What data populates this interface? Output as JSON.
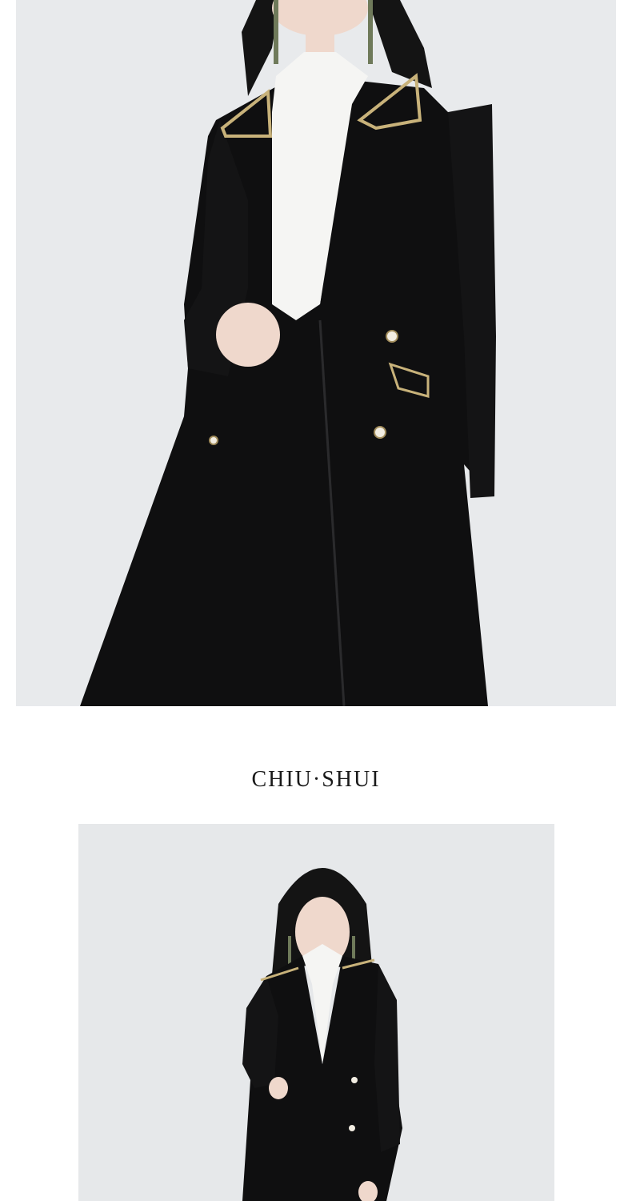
{
  "brand": {
    "name": "CHIU·SHUI"
  },
  "images": [
    {
      "name": "model-closeup",
      "subject": "woman-in-black-coat-closeup"
    },
    {
      "name": "model-full",
      "subject": "woman-in-black-coat-full"
    }
  ],
  "colors": {
    "background": "#ffffff",
    "photo_bg": "#e6e8ea",
    "coat": "#0f0f10",
    "blouse": "#f4f4f2",
    "trim": "#c8b27a"
  }
}
